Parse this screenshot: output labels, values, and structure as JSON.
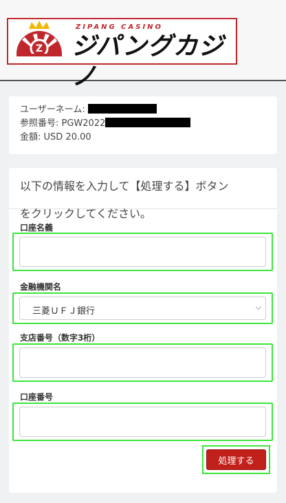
{
  "brand": {
    "sub": "ZIPANG CASINO",
    "name": "ジパングカジノ",
    "logo_color": "#c0272d"
  },
  "info": {
    "username_label": "ユーザーネーム:",
    "reference_label": "参照番号: PGW2022",
    "amount_label": "金額: USD 20.00"
  },
  "form": {
    "instruction_line1": "以下の情報を入力して【処理する】ボタン",
    "instruction_line2": "をクリックしてください。",
    "account_name_label": "口座名義",
    "account_name_value": "",
    "bank_label": "金融機関名",
    "bank_selected": "三菱ＵＦＪ銀行",
    "branch_label": "支店番号（数字3桁）",
    "branch_value": "",
    "account_number_label": "口座番号",
    "account_number_value": "",
    "submit_label": "処理する",
    "submit_color": "#c1201b",
    "highlight_color": "#39e639"
  }
}
